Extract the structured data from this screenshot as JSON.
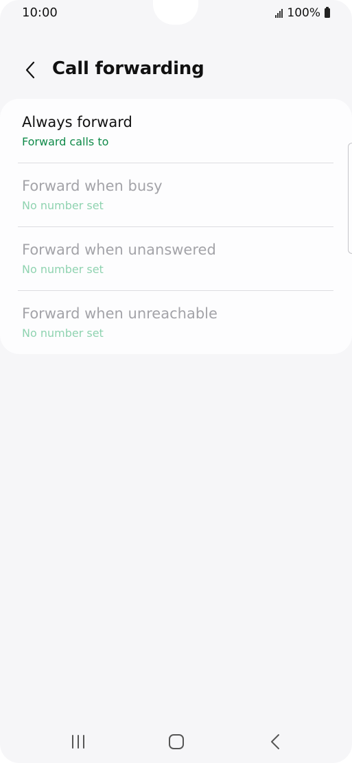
{
  "status_bar": {
    "time": "10:00",
    "battery": "100%"
  },
  "header": {
    "title": "Call forwarding",
    "back_icon": "chevron-left-icon"
  },
  "items": [
    {
      "title": "Always forward",
      "subtitle": "Forward calls to",
      "enabled": true
    },
    {
      "title": "Forward when busy",
      "subtitle": "No number set",
      "enabled": false
    },
    {
      "title": "Forward when unanswered",
      "subtitle": "No number set",
      "enabled": false
    },
    {
      "title": "Forward when unreachable",
      "subtitle": "No number set",
      "enabled": false
    }
  ],
  "nav_bar": {
    "recents_icon": "recents-icon",
    "home_icon": "home-icon",
    "back_icon": "back-icon"
  },
  "colors": {
    "accent_green": "#0f8a49",
    "disabled_green": "#8fd3b0",
    "background": "#f6f6f8",
    "card": "#fdfdfe"
  }
}
